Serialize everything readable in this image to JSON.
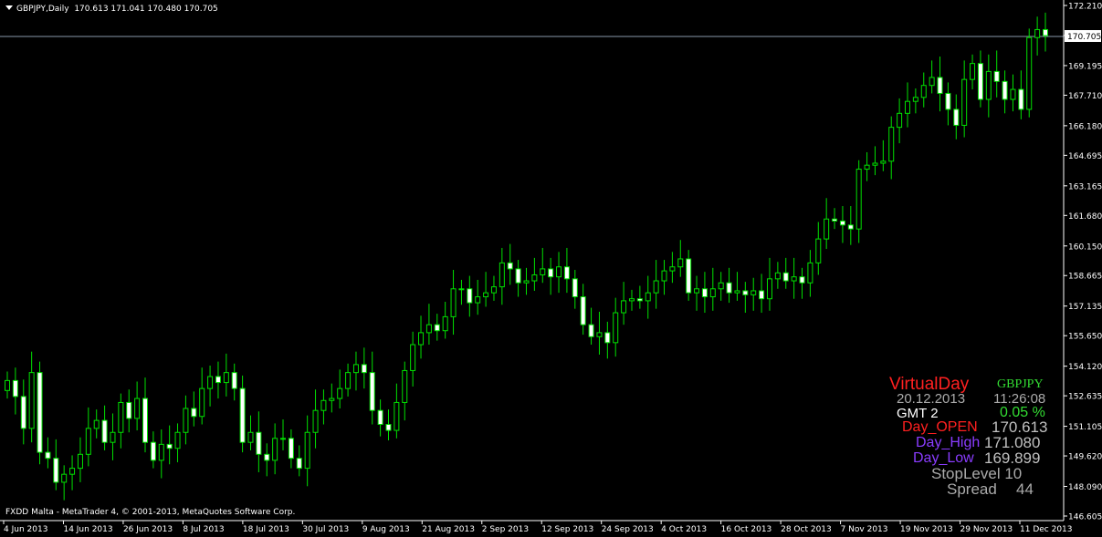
{
  "header": {
    "menu_icon": "triangle-down-icon",
    "symbol_tf": "GBPJPY,Daily",
    "ohlc": "170.613 171.041 170.480 170.705"
  },
  "footer": {
    "copyright": "FXDD Malta - MetaTrader 4, © 2001-2013, MetaQuotes Software Corp."
  },
  "overlay": {
    "title": "VirtualDay",
    "symbol": "GBPJPY",
    "date": "20.12.2013",
    "time": "11:26:08",
    "gmt": "GMT 2",
    "change": "0.05 %",
    "day_open_label": "Day_OPEN",
    "day_open_value": "170.613",
    "day_high_label": "Day_High",
    "day_high_value": "171.080",
    "day_low_label": "Day_Low",
    "day_low_value": "169.899",
    "stoplevel": "StopLevel 10",
    "spread_label": "Spread",
    "spread_value": "44"
  },
  "colors": {
    "background": "#000000",
    "axis": "#ffffff",
    "candle_up_fill": "#000000",
    "candle_down_fill": "#ffffff",
    "candle_outline": "#00e000",
    "bid_line": "#8899aa",
    "title": "#ff2020",
    "symbol": "#33dd33",
    "date_time": "#aaaaaa",
    "gmt": "#ffffff",
    "change": "#33dd33",
    "day_open_label": "#ff2020",
    "day_high_low_label": "#8a3cff",
    "values": "#c0c0c0"
  },
  "chart_data": {
    "type": "candlestick",
    "symbol": "GBPJPY",
    "timeframe": "Daily",
    "ylim": [
      146.605,
      172.21
    ],
    "y_ticks": [
      "172.210",
      "170.705",
      "169.195",
      "167.710",
      "166.180",
      "164.695",
      "163.165",
      "161.680",
      "160.150",
      "158.665",
      "157.135",
      "155.650",
      "154.120",
      "152.635",
      "151.105",
      "149.620",
      "148.090",
      "146.605"
    ],
    "current_price": "170.705",
    "x_ticks": [
      "4 Jun 2013",
      "14 Jun 2013",
      "26 Jun 2013",
      "8 Jul 2013",
      "18 Jul 2013",
      "30 Jul 2013",
      "9 Aug 2013",
      "21 Aug 2013",
      "2 Sep 2013",
      "12 Sep 2013",
      "24 Sep 2013",
      "4 Oct 2013",
      "16 Oct 2013",
      "28 Oct 2013",
      "7 Nov 2013",
      "19 Nov 2013",
      "29 Nov 2013",
      "11 Dec 2013"
    ],
    "close": [
      153.4,
      152.6,
      151.0,
      153.8,
      149.8,
      149.5,
      148.3,
      148.7,
      149.0,
      149.7,
      151.0,
      151.4,
      150.3,
      150.8,
      152.3,
      151.5,
      152.5,
      150.3,
      149.4,
      150.2,
      150.0,
      150.8,
      152.0,
      151.6,
      153.0,
      153.6,
      153.3,
      153.8,
      153.0,
      150.3,
      150.8,
      149.7,
      149.4,
      150.5,
      150.5,
      149.5,
      149.0,
      150.8,
      151.9,
      152.4,
      152.5,
      153.0,
      153.8,
      154.2,
      153.8,
      151.9,
      151.2,
      150.9,
      152.3,
      153.9,
      155.2,
      155.8,
      156.2,
      155.9,
      156.6,
      158.0,
      158.0,
      157.3,
      157.6,
      157.8,
      158.1,
      159.3,
      159.0,
      158.3,
      158.4,
      158.7,
      159.0,
      158.6,
      159.1,
      158.5,
      157.6,
      156.2,
      155.6,
      155.8,
      155.3,
      156.8,
      157.4,
      157.5,
      157.4,
      157.8,
      158.4,
      158.9,
      159.1,
      159.5,
      157.8,
      158.0,
      157.6,
      158.0,
      158.3,
      157.8,
      157.9,
      157.7,
      157.9,
      157.5,
      158.5,
      158.8,
      158.4,
      158.6,
      158.3,
      159.3,
      160.5,
      161.5,
      161.4,
      161.2,
      161.0,
      164.0,
      164.2,
      164.3,
      164.4,
      166.1,
      166.8,
      167.4,
      167.6,
      168.2,
      168.6,
      167.8,
      167.0,
      166.2,
      168.5,
      169.3,
      167.5,
      168.9,
      168.4,
      167.5,
      168.0,
      167.0,
      170.6,
      171.0,
      170.7
    ]
  }
}
